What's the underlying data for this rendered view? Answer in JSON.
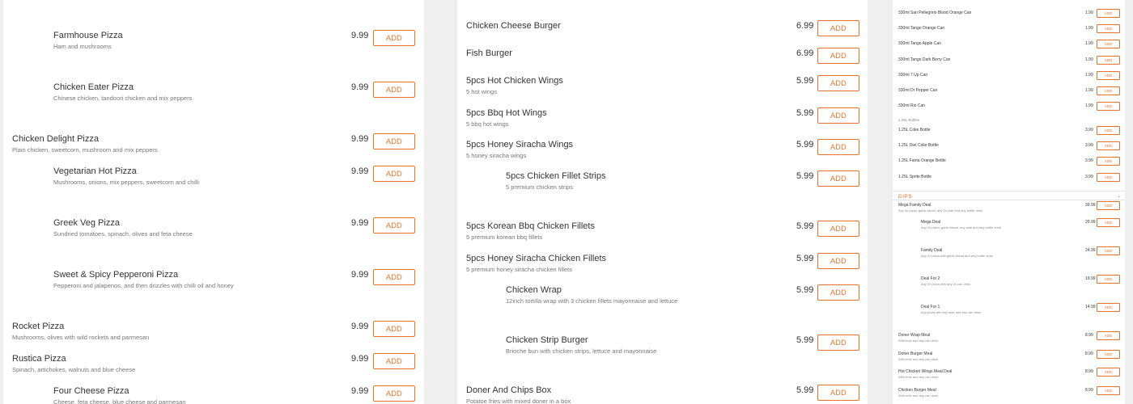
{
  "accent": "#e8722c",
  "add_label": "ADD",
  "panel1": [
    {
      "name": "Farmhouse Pizza",
      "desc": "Ham and mushrooms",
      "price": "9.99"
    },
    {
      "name": "Chicken Eater Pizza",
      "desc": "Chinese chicken, tandoori chicken and mix peppers",
      "price": "9.99"
    },
    {
      "name": "Chicken Delight Pizza",
      "desc": "Plain chicken, sweetcorn, mushroom and mix peppers",
      "price": "9.99"
    },
    {
      "name": "Vegetarian Hot Pizza",
      "desc": "Mushrooms, onions, mix peppers, sweetcorn and chilli",
      "price": "9.99"
    },
    {
      "name": "Greek Veg Pizza",
      "desc": "Sundried tomatoes, spinach, olives and feta cheese",
      "price": "9.99"
    },
    {
      "name": "Sweet & Spicy Pepperoni Pizza",
      "desc": "Pepperoni and jalapenos, and then drizzles with chilli oil and honey",
      "price": "9.99"
    },
    {
      "name": "Rocket Pizza",
      "desc": "Mushrooms, olives with wild rockets and parmesan",
      "price": "9.99"
    },
    {
      "name": "Rustica Pizza",
      "desc": "Spinach, artichokes, walnuts and blue cheese",
      "price": "9.99"
    },
    {
      "name": "Four Cheese Pizza",
      "desc": "Cheese, feta cheese, blue cheese and parmesan",
      "price": "9.99"
    }
  ],
  "panel2": [
    {
      "name": "Chicken Cheese Burger",
      "desc": "",
      "price": "6.99"
    },
    {
      "name": "Fish Burger",
      "desc": "",
      "price": "6.99"
    },
    {
      "name": "5pcs Hot Chicken Wings",
      "desc": "5 hot wings",
      "price": "5.99"
    },
    {
      "name": "5pcs Bbq Hot Wings",
      "desc": "5 bbq hot wings",
      "price": "5.99"
    },
    {
      "name": "5pcs Honey Siracha Wings",
      "desc": "5 honey siracha wings",
      "price": "5.99"
    },
    {
      "name": "5pcs Chicken Fillet Strips",
      "desc": "5 premium chicken strips",
      "price": "5.99"
    },
    {
      "name": "5pcs Korean Bbq Chicken Fillets",
      "desc": "5 premium korean bbq fillets",
      "price": "5.99"
    },
    {
      "name": "5pcs Honey Siracha Chicken Fillets",
      "desc": "5 premium honey siracha chicken fillets",
      "price": "5.99"
    },
    {
      "name": "Chicken Wrap",
      "desc": "12inch tortilla wrap with 3 chicken fillets mayonnaise and lettuce",
      "price": "5.99"
    },
    {
      "name": "Chicken Strip Burger",
      "desc": "Brioche bun with chicken strips, lettuce and mayonnaise",
      "price": "5.99"
    },
    {
      "name": "Doner And Chips Box",
      "desc": "Potatoe fries with mixed doner in a box",
      "price": "5.99"
    }
  ],
  "panel3_cans": [
    {
      "name": "330ml San Pellegrino Blood Orange Can",
      "price": "1.99"
    },
    {
      "name": "330ml Tango Orange Can",
      "price": "1.99"
    },
    {
      "name": "330ml Tango Apple Can",
      "price": "1.99"
    },
    {
      "name": "330ml Tango Dark Berry Can",
      "price": "1.99"
    },
    {
      "name": "330ml 7 Up Can",
      "price": "1.99"
    },
    {
      "name": "330ml Dr Pepper Can",
      "price": "1.99"
    },
    {
      "name": "330ml Rio Can",
      "price": "1.99"
    }
  ],
  "panel3_bottles_header": "1.25L Bottles",
  "panel3_bottles": [
    {
      "name": "1.25L Coke Bottle",
      "price": "3.99"
    },
    {
      "name": "1.25L Diet Coke Bottle",
      "price": "3.99"
    },
    {
      "name": "1.25L Fanta Orange Bottle",
      "price": "3.99"
    },
    {
      "name": "1.25L Sprite Bottle",
      "price": "3.99"
    }
  ],
  "dips_label": "DIPS",
  "panel3_deals": [
    {
      "name": "Mega Family Deal",
      "desc": "Any 3x pizza, garlic bread, any 2x side and any bottle drink",
      "price": "39.99"
    },
    {
      "name": "Mega Deal",
      "desc": "Any 2x pizza, garlic bread, any side and any bottle drink",
      "price": "29.99"
    },
    {
      "name": "Family Deal",
      "desc": "Any 2x pizza with garlic bread and any bottle drink",
      "price": "24.99"
    },
    {
      "name": "Deal For 2",
      "desc": "Any 2x pizza with any 2x can drink",
      "price": "19.99"
    },
    {
      "name": "Deal For 1",
      "desc": "Any pizza with any side and any can drink",
      "price": "14.99"
    }
  ],
  "panel3_meals": [
    {
      "name": "Doner Wrap Meal",
      "desc": "With fries and any can drink",
      "price": "8.99"
    },
    {
      "name": "Doner Burger Meal",
      "desc": "With fries and any can drink",
      "price": "8.99"
    },
    {
      "name": "Hot Chicken Wings Meal Deal",
      "desc": "With fries and any can drink",
      "price": "8.99"
    },
    {
      "name": "Chicken Burger Meal",
      "desc": "With fries and any can drink",
      "price": "8.99"
    }
  ]
}
